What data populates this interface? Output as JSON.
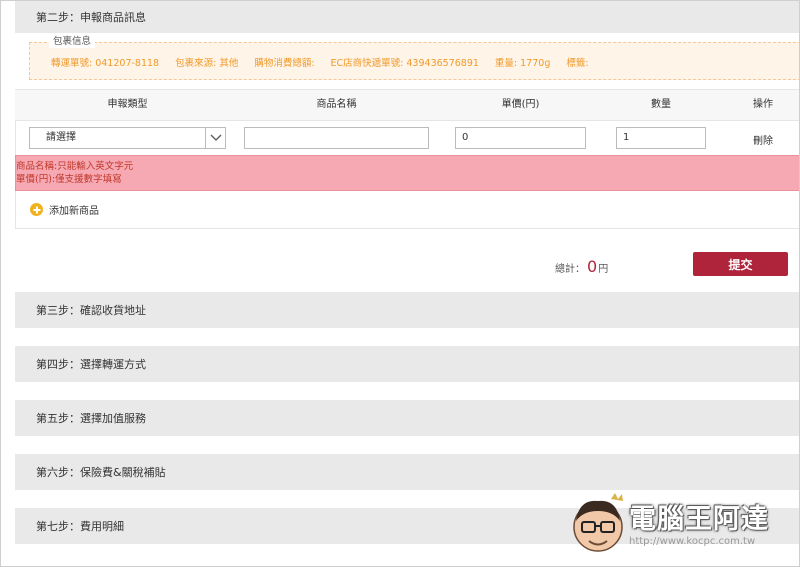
{
  "step2": {
    "title": "第二步：申報商品訊息"
  },
  "package": {
    "title": "包裹信息",
    "transfer_no": "轉運單號: 041207-8118",
    "source": "包裹來源: 其他",
    "total_spend": "購物消費總額:",
    "ec_tracking": "EC店商快遞單號: 439436576891",
    "weight": "重量: 1770g",
    "tags": "標籤:"
  },
  "table": {
    "headers": [
      "申報類型",
      "商品名稱",
      "單價(円)",
      "數量",
      "操作"
    ],
    "row": {
      "type_select": "請選擇",
      "product_name": "",
      "unit_price": "0",
      "quantity": "1",
      "delete": "刪除"
    }
  },
  "errors": [
    "商品名稱:只能輸入英文字元",
    "單價(円):僅支援數字填寫"
  ],
  "add_product": "添加新商品",
  "total": {
    "label": "總計：",
    "value": "0",
    "unit": "円"
  },
  "submit": "提交",
  "steps": [
    {
      "title": "第三步：確認收貨地址"
    },
    {
      "title": "第四步：選擇轉運方式"
    },
    {
      "title": "第五步：選擇加值服務"
    },
    {
      "title": "第六步：保險費&關稅補貼"
    },
    {
      "title": "第七步：費用明細"
    }
  ],
  "watermark": {
    "name": "電腦王阿達",
    "url": "http://www.kocpc.com.tw"
  },
  "colors": {
    "accent": "#b0243b",
    "orange_text": "#f09a2a",
    "error_bg": "#f6a8b3",
    "add_icon": "#f0b21c"
  }
}
